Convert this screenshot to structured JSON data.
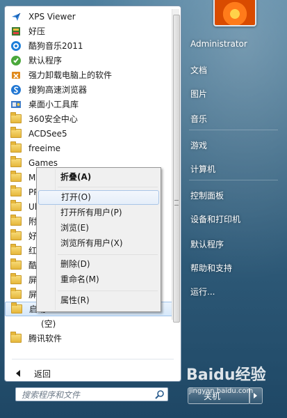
{
  "programs": [
    {
      "label": "XPS Viewer",
      "icon": "xps-viewer-icon"
    },
    {
      "label": "好压",
      "icon": "haozip-icon"
    },
    {
      "label": "酷狗音乐2011",
      "icon": "kugou-icon"
    },
    {
      "label": "默认程序",
      "icon": "default-programs-icon"
    },
    {
      "label": "强力卸载电脑上的软件",
      "icon": "uninstaller-icon"
    },
    {
      "label": "搜狗高速浏览器",
      "icon": "sogou-browser-icon"
    },
    {
      "label": "桌面小工具库",
      "icon": "gadgets-icon"
    },
    {
      "label": "360安全中心",
      "icon": "folder-icon"
    },
    {
      "label": "ACDSee5",
      "icon": "folder-icon"
    },
    {
      "label": "freeime",
      "icon": "folder-icon"
    },
    {
      "label": "Games",
      "icon": "folder-icon"
    },
    {
      "label": "Mic",
      "icon": "folder-icon"
    },
    {
      "label": "PPL",
      "icon": "folder-icon"
    },
    {
      "label": "Ultr",
      "icon": "folder-icon"
    },
    {
      "label": "附件",
      "icon": "folder-icon"
    },
    {
      "label": "好压",
      "icon": "folder-icon"
    },
    {
      "label": "红色",
      "icon": "folder-icon"
    },
    {
      "label": "酷狗",
      "icon": "folder-icon"
    },
    {
      "label": "屏幕",
      "icon": "folder-icon"
    },
    {
      "label": "屏幕",
      "icon": "folder-icon"
    },
    {
      "label": "启动",
      "icon": "folder-icon"
    },
    {
      "label": "(空)",
      "icon": ""
    },
    {
      "label": "腾讯软件",
      "icon": "folder-icon"
    }
  ],
  "back_label": "返回",
  "search": {
    "placeholder": "搜索程序和文件"
  },
  "right_menu": [
    {
      "label": "Administrator"
    },
    {
      "label": "文档"
    },
    {
      "label": "图片"
    },
    {
      "label": "音乐"
    },
    {
      "label": "游戏"
    },
    {
      "label": "计算机"
    },
    {
      "label": "控制面板"
    },
    {
      "label": "设备和打印机"
    },
    {
      "label": "默认程序"
    },
    {
      "label": "帮助和支持"
    },
    {
      "label": "运行..."
    }
  ],
  "shutdown_label": "关机",
  "context_menu": {
    "items": [
      {
        "label": "折叠(A)"
      },
      {
        "label": "打开(O)"
      },
      {
        "label": "打开所有用户(P)"
      },
      {
        "label": "浏览(E)"
      },
      {
        "label": "浏览所有用户(X)"
      },
      {
        "label": "删除(D)"
      },
      {
        "label": "重命名(M)"
      },
      {
        "label": "属性(R)"
      }
    ]
  },
  "watermark": {
    "main": "Baidu经验",
    "sub": "jingyan.baidu.com"
  }
}
